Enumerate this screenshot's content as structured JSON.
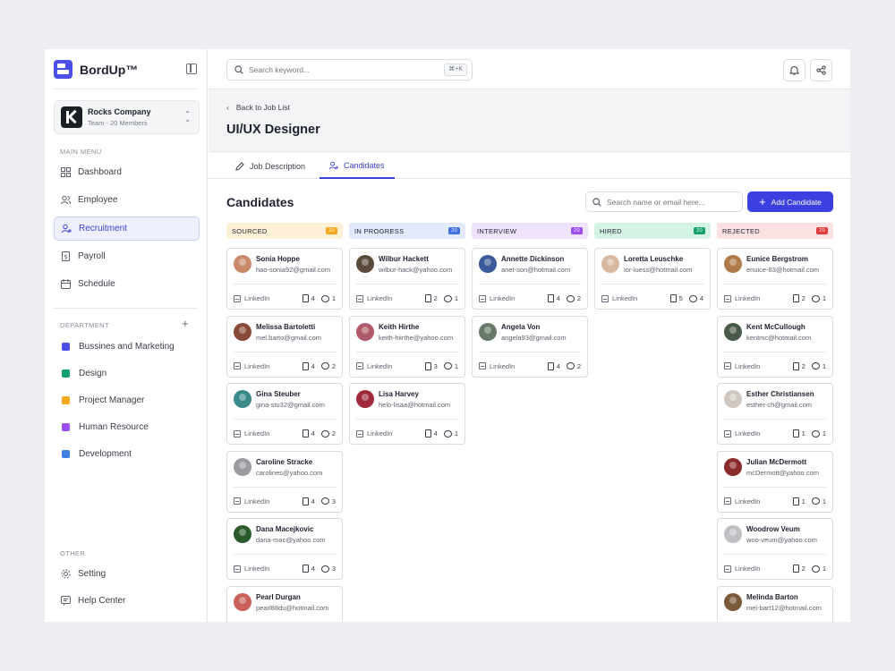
{
  "app": {
    "name": "BordUp™"
  },
  "company": {
    "name": "Rocks Company",
    "sub": "Team - 20 Members"
  },
  "sidebar": {
    "main_label": "MAIN MENU",
    "items": [
      {
        "label": "Dashboard",
        "icon": "grid-icon"
      },
      {
        "label": "Employee",
        "icon": "users-icon"
      },
      {
        "label": "Recruitment",
        "icon": "user-plus-icon"
      },
      {
        "label": "Payroll",
        "icon": "dollar-doc-icon"
      },
      {
        "label": "Schedule",
        "icon": "calendar-icon"
      }
    ],
    "department_label": "DEPARTMENT",
    "departments": [
      {
        "label": "Bussines and Marketing",
        "color": "#4b4fe8"
      },
      {
        "label": "Design",
        "color": "#14a06e"
      },
      {
        "label": "Project Manager",
        "color": "#f3a81d"
      },
      {
        "label": "Human Resource",
        "color": "#9b4ded"
      },
      {
        "label": "Development",
        "color": "#3f7fe6"
      }
    ],
    "other_label": "OTHER",
    "other_items": [
      {
        "label": "Setting",
        "icon": "gear-icon"
      },
      {
        "label": "Help Center",
        "icon": "help-icon"
      }
    ]
  },
  "topbar": {
    "search_placeholder": "Search keyword...",
    "shortcut": "⌘+K"
  },
  "header": {
    "back_label": "Back to Job List",
    "title": "UI/UX Designer"
  },
  "tabs": [
    {
      "label": "Job Description"
    },
    {
      "label": "Candidates"
    }
  ],
  "candidates_section": {
    "title": "Candidates",
    "search_placeholder": "Search name or email here...",
    "add_label": "Add Candidate"
  },
  "columns": [
    {
      "title": "SOURCED",
      "count": "20",
      "bg": "#fdf0d7",
      "badge": "#f3a81d"
    },
    {
      "title": "IN PROGRESS",
      "count": "20",
      "bg": "#e1e9fb",
      "badge": "#3f6fe0"
    },
    {
      "title": "INTERVIEW",
      "count": "20",
      "bg": "#efe3fb",
      "badge": "#9b4ded"
    },
    {
      "title": "HIRED",
      "count": "20",
      "bg": "#d4f3e4",
      "badge": "#14a06e"
    },
    {
      "title": "REJECTED",
      "count": "20",
      "bg": "#fbe1e1",
      "badge": "#e03c3c"
    }
  ],
  "card_link_label": "LinkedIn",
  "cards": [
    [
      {
        "name": "Sonia Hoppe",
        "email": "hao-sonia92@gmail.com",
        "docs": "4",
        "comments": "1",
        "avatar": "#c98a6a"
      },
      {
        "name": "Melissa Bartoletti",
        "email": "mel.barto@gmail.com",
        "docs": "4",
        "comments": "2",
        "avatar": "#8a4a3a"
      },
      {
        "name": "Gina Steuber",
        "email": "gina-stu32@gmail.com",
        "docs": "4",
        "comments": "2",
        "avatar": "#3a8a8a"
      },
      {
        "name": "Caroline Stracke",
        "email": "carolines@yahoo.com",
        "docs": "4",
        "comments": "3",
        "avatar": "#9a9aa0"
      },
      {
        "name": "Dana Macejkovic",
        "email": "dana-mac@yahoo.com",
        "docs": "4",
        "comments": "3",
        "avatar": "#2a5a2a"
      },
      {
        "name": "Pearl Durgan",
        "email": "pearl88du@hotmail.com",
        "docs": "",
        "comments": "",
        "avatar": "#c9605a"
      }
    ],
    [
      {
        "name": "Wilbur Hackett",
        "email": "wilbur-hack@yahoo.com",
        "docs": "2",
        "comments": "1",
        "avatar": "#5a4a3a"
      },
      {
        "name": "Keith Hirthe",
        "email": "keith-hiirthe@yahoo.com",
        "docs": "3",
        "comments": "1",
        "avatar": "#b05a6a"
      },
      {
        "name": "Lisa Harvey",
        "email": "helo-lisaa@hotmail.com",
        "docs": "4",
        "comments": "1",
        "avatar": "#a02a3a"
      }
    ],
    [
      {
        "name": "Annette Dickinson",
        "email": "anet-son@hotmail.com",
        "docs": "4",
        "comments": "2",
        "avatar": "#3a5a9a"
      },
      {
        "name": "Angela Von",
        "email": "angela93@gmail.com",
        "docs": "4",
        "comments": "2",
        "avatar": "#6a7a6a"
      }
    ],
    [
      {
        "name": "Loretta Leuschke",
        "email": "lor-luess@hotmail.com",
        "docs": "5",
        "comments": "4",
        "avatar": "#d9b8a0"
      }
    ],
    [
      {
        "name": "Eunice Bergstrom",
        "email": "enuice-83@hotmail.com",
        "docs": "2",
        "comments": "1",
        "avatar": "#b07a4a"
      },
      {
        "name": "Kent McCullough",
        "email": "kentmc@hotmail.com",
        "docs": "2",
        "comments": "1",
        "avatar": "#4a5a4a"
      },
      {
        "name": "Esther Christiansen",
        "email": "esther-ch@gmail.com",
        "docs": "1",
        "comments": "1",
        "avatar": "#d0c8c0"
      },
      {
        "name": "Julian McDermott",
        "email": "mcDermott@yahoo.com",
        "docs": "1",
        "comments": "1",
        "avatar": "#8a2a2a"
      },
      {
        "name": "Woodrow Veum",
        "email": "woo-veum@yahoo.com",
        "docs": "2",
        "comments": "1",
        "avatar": "#c0c0c4"
      },
      {
        "name": "Melinda Barton",
        "email": "mel-bart12@hotmail.com",
        "docs": "",
        "comments": "",
        "avatar": "#7a5a3a"
      }
    ]
  ]
}
